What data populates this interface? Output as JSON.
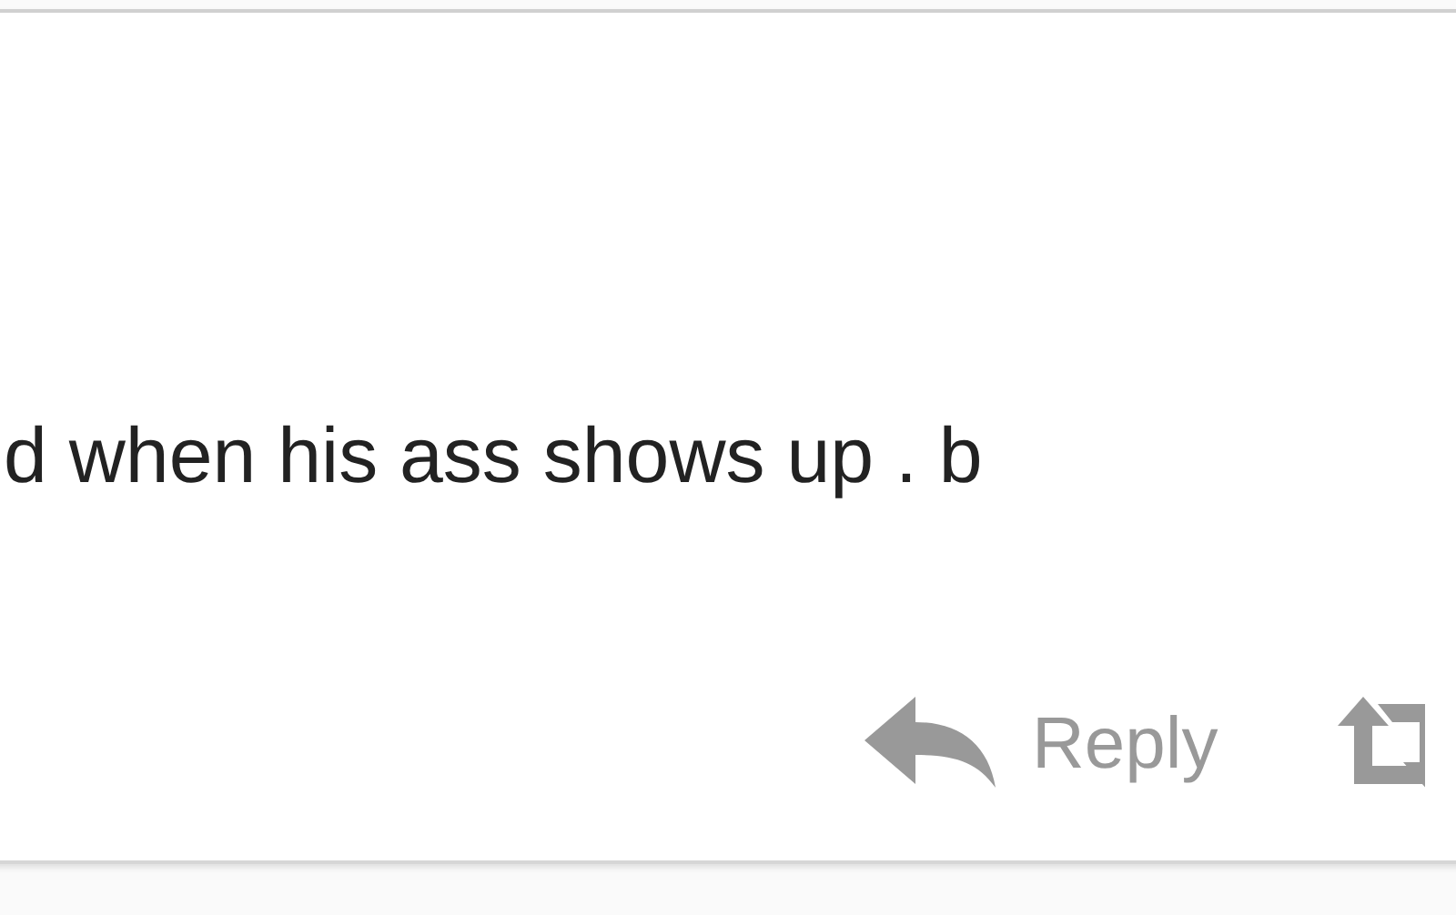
{
  "tweet": {
    "text": "d when his ass shows up . b",
    "actions": [
      {
        "kind": "reply",
        "label": "Reply"
      },
      {
        "kind": "retweet"
      }
    ]
  }
}
